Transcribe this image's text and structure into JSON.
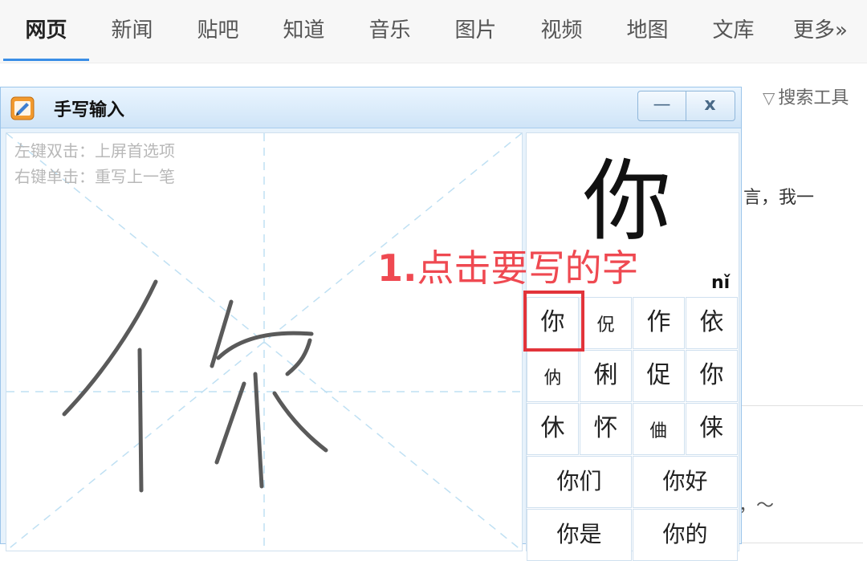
{
  "nav": {
    "items": [
      {
        "label": "网页",
        "active": true
      },
      {
        "label": "新闻"
      },
      {
        "label": "贴吧"
      },
      {
        "label": "知道"
      },
      {
        "label": "音乐"
      },
      {
        "label": "图片"
      },
      {
        "label": "视频"
      },
      {
        "label": "地图"
      },
      {
        "label": "文库"
      },
      {
        "label": "更多»"
      }
    ],
    "accent": "#3a8ee6"
  },
  "toolbar": {
    "search_tools_label": "搜索工具"
  },
  "background": {
    "text_1": "言，我一",
    "text_2": "，～"
  },
  "handwriting_window": {
    "title": "手写输入",
    "minimize_label": "—",
    "close_label": "x",
    "hints": [
      "左键双击：上屏首选项",
      "右键单击：重写上一笔"
    ],
    "drawn_character": "你",
    "preview": {
      "character": "你",
      "pinyin": "nǐ"
    },
    "candidates": [
      "你",
      "㑆",
      "作",
      "依",
      "㐻",
      "俐",
      "促",
      "你",
      "休",
      "怀",
      "㑋",
      "俫"
    ],
    "phrases": [
      "你们",
      "你好",
      "你是",
      "你的"
    ],
    "selected_index": 0
  },
  "annotation": {
    "number": "1.",
    "text": "点击要写的字",
    "color": "#ee3a43"
  }
}
